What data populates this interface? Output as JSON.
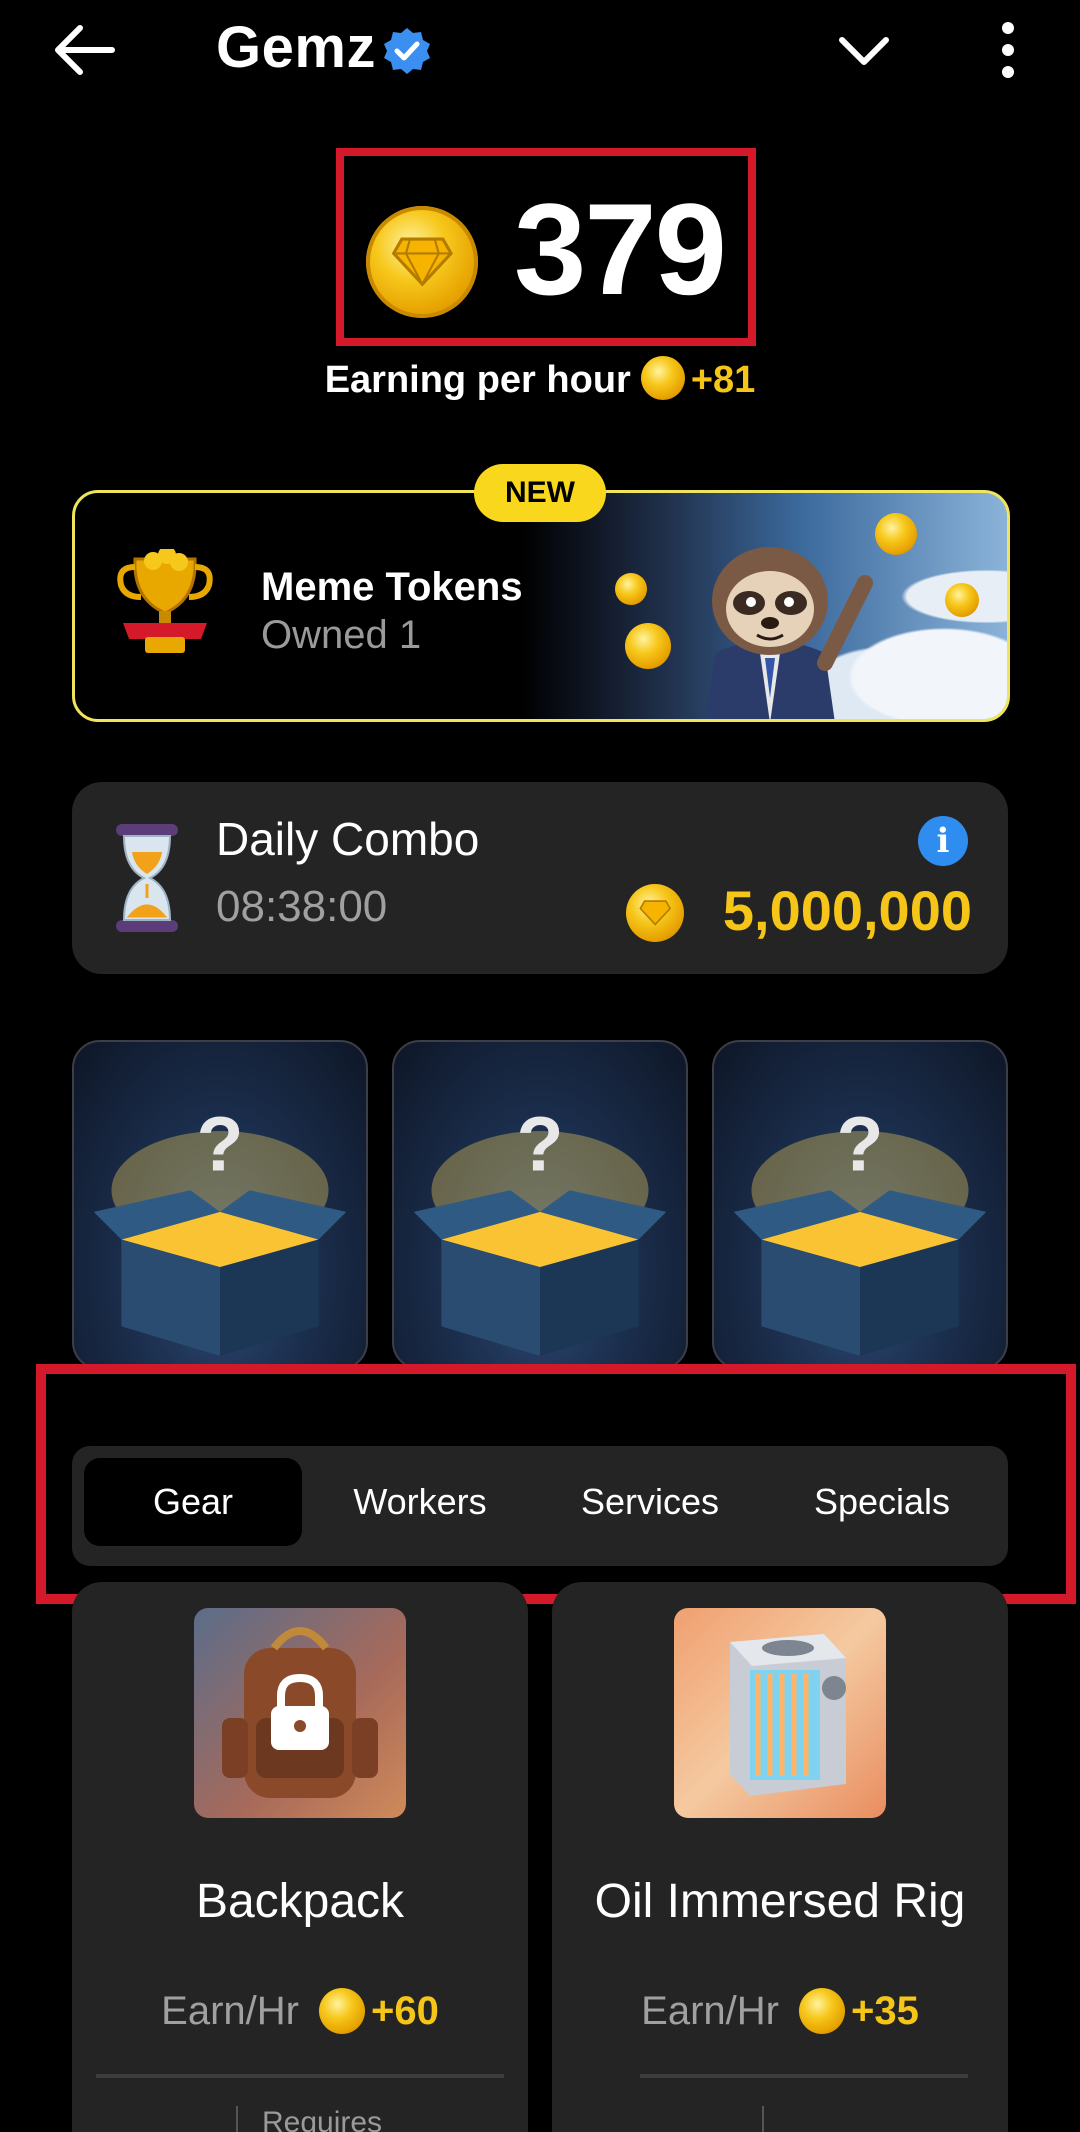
{
  "header": {
    "title": "Gemz",
    "icons": [
      "back-arrow-icon",
      "verified-badge-icon",
      "chevron-down-icon",
      "more-vertical-icon"
    ]
  },
  "balance": {
    "value": "379",
    "earning_label": "Earning per hour",
    "earning_value": "+81"
  },
  "banner": {
    "badge": "NEW",
    "title": "Meme Tokens",
    "subtitle": "Owned 1"
  },
  "combo": {
    "title": "Daily Combo",
    "timer": "08:38:00",
    "reward": "5,000,000",
    "info_glyph": "i"
  },
  "mystery_cards": [
    {
      "glyph": "?"
    },
    {
      "glyph": "?"
    },
    {
      "glyph": "?"
    }
  ],
  "tabs": [
    {
      "label": "Gear",
      "active": true
    },
    {
      "label": "Workers",
      "active": false
    },
    {
      "label": "Services",
      "active": false
    },
    {
      "label": "Specials",
      "active": false
    }
  ],
  "items": [
    {
      "name": "Backpack",
      "earn_label": "Earn/Hr",
      "earn_value": "+60",
      "locked": true,
      "footer": "Requires"
    },
    {
      "name": "Oil Immersed Rig",
      "earn_label": "Earn/Hr",
      "earn_value": "+35",
      "locked": false
    }
  ],
  "colors": {
    "accent_gold": "#f5c518",
    "highlight_red": "#d41a2a",
    "card_bg": "#242424",
    "info_blue": "#2f8df0",
    "banner_border": "#f0e45a"
  }
}
